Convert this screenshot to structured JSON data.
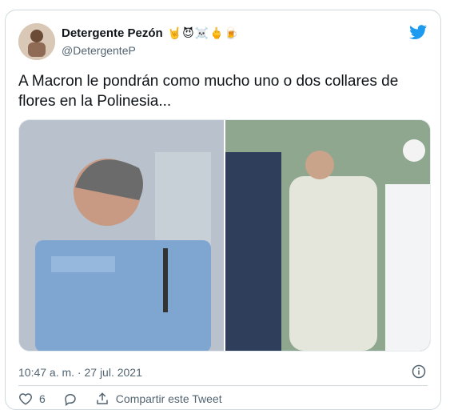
{
  "tweet": {
    "display_name": "Detergente Pezón",
    "emojis": "🤘😈☠️🖕🍺",
    "handle": "@DetergenteP",
    "text": "A Macron le pondrán como mucho uno o dos collares de flores en la Polinesia...",
    "timestamp": "10:47 a. m. · 27 jul. 2021",
    "like_count": "6",
    "share_label": "Compartir este Tweet"
  },
  "icons": {
    "avatar": "avatar",
    "twitter": "twitter-bird-icon",
    "info": "info-icon",
    "like": "heart-icon",
    "reply": "reply-icon",
    "share": "share-icon"
  },
  "colors": {
    "twitter_blue": "#1d9bf0",
    "muted_text": "#536471",
    "border": "#cfd9de"
  }
}
